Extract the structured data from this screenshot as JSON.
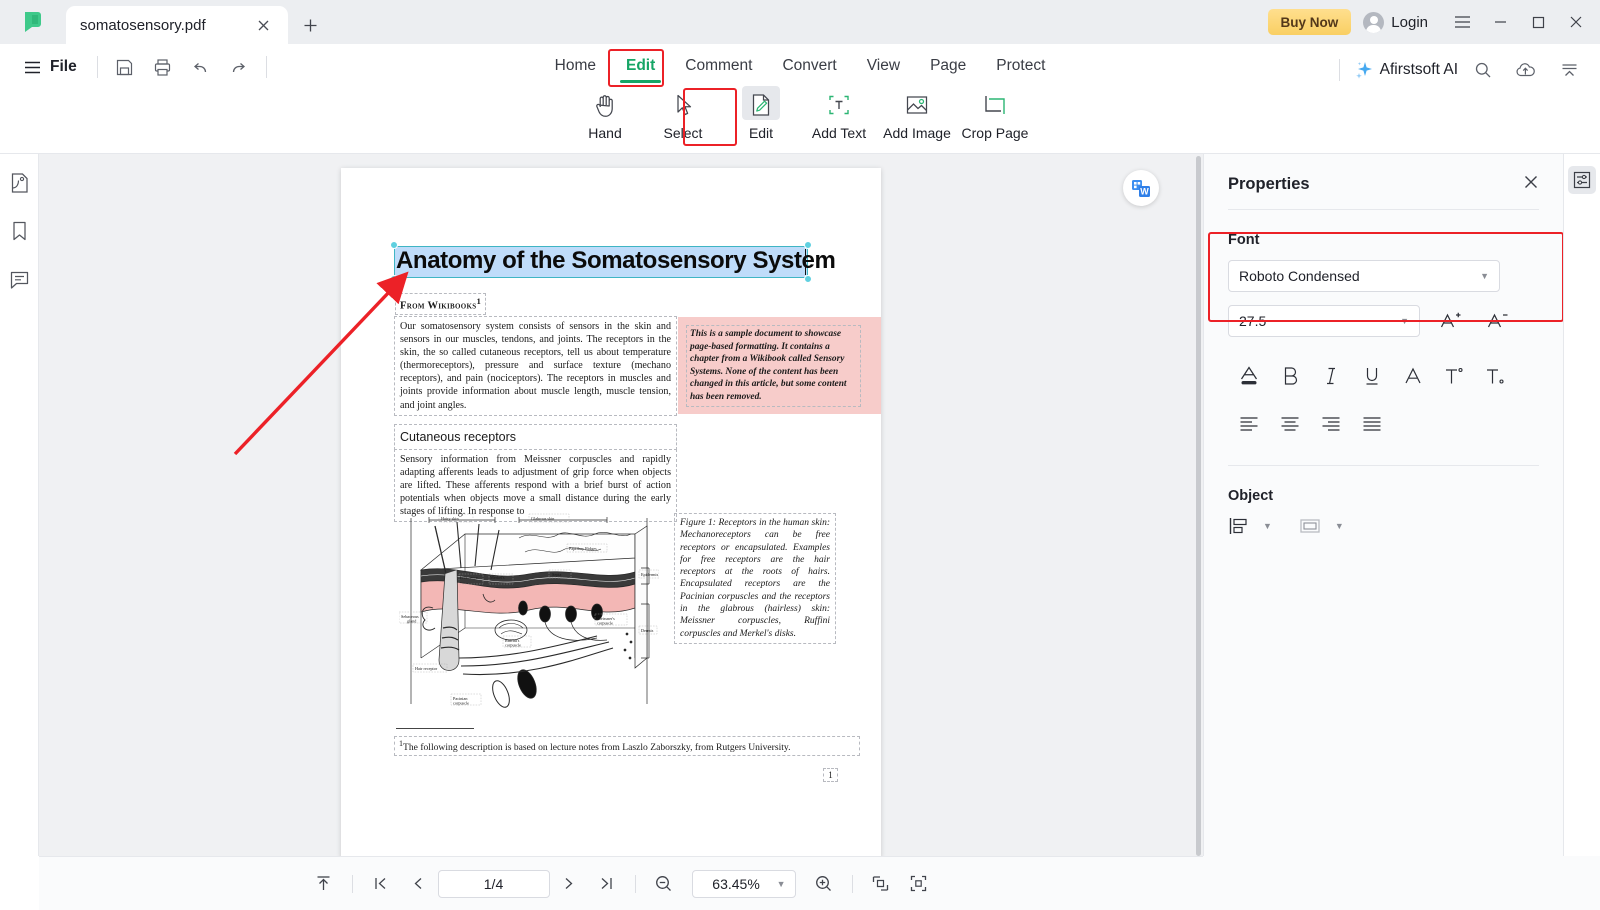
{
  "titlebar": {
    "logo_icon": "afirstsoft-logo-icon",
    "tab_title": "somatosensory.pdf",
    "close_icon": "close-icon",
    "new_tab_icon": "plus-icon",
    "buy_now_label": "Buy Now",
    "login_label": "Login",
    "menu_icon": "hamburger-menu-icon",
    "minimize_icon": "minimize-icon",
    "maximize_icon": "maximize-icon",
    "window_close_icon": "close-icon"
  },
  "ribbon": {
    "file_label": "File",
    "quick_icons": [
      "save-icon",
      "print-icon",
      "undo-icon",
      "redo-icon"
    ],
    "tabs": [
      {
        "label": "Home",
        "active": false
      },
      {
        "label": "Edit",
        "active": true
      },
      {
        "label": "Comment",
        "active": false
      },
      {
        "label": "Convert",
        "active": false
      },
      {
        "label": "View",
        "active": false
      },
      {
        "label": "Page",
        "active": false
      },
      {
        "label": "Protect",
        "active": false
      }
    ],
    "ai_label": "Afirstsoft AI",
    "search_icon": "search-icon",
    "cloud_upload_icon": "cloud-upload-icon",
    "collapse_ribbon_icon": "collapse-ribbon-icon",
    "tools": [
      {
        "label": "Hand",
        "icon": "hand-icon",
        "selected": false
      },
      {
        "label": "Select",
        "icon": "cursor-arrow-icon",
        "selected": false
      },
      {
        "label": "Edit",
        "icon": "edit-document-icon",
        "selected": true
      },
      {
        "label": "Add Text",
        "icon": "add-text-icon",
        "selected": false
      },
      {
        "label": "Add Image",
        "icon": "add-image-icon",
        "selected": false
      },
      {
        "label": "Crop Page",
        "icon": "crop-page-icon",
        "selected": false
      }
    ]
  },
  "left_rail": {
    "items": [
      {
        "icon": "page-thumbnails-icon"
      },
      {
        "icon": "bookmark-icon"
      },
      {
        "icon": "comment-icon"
      }
    ]
  },
  "viewer": {
    "convert_to_word_icon": "convert-to-word-icon",
    "document": {
      "title": "Anatomy of the Somatosensory System",
      "source_line": "From Wikibooks",
      "source_footnote_marker": "1",
      "paragraph_1": "Our somatosensory system consists of sensors in the skin and sensors in our muscles, tendons, and joints. The receptors in the skin, the so called cutaneous receptors, tell us about temperature (thermoreceptors), pressure and surface texture (mechano receptors), and pain (nociceptors). The receptors in muscles and joints provide information about muscle length, muscle tension, and joint angles.",
      "pink_note": "This is a sample document to showcase page-based formatting. It contains a chapter from a Wikibook called Sensory Systems. None of the content has been changed in this article, but some content has been removed.",
      "heading_2": "Cutaneous receptors",
      "paragraph_2": "Sensory information from Meissner corpuscles and rapidly adapting afferents leads to adjustment of grip force when objects are lifted. These afferents respond with a brief burst of action potentials when objects move a small distance during the early stages of lifting. In response to",
      "figure_caption": "Figure 1: Receptors in the human skin: Mechanoreceptors can be free receptors or encapsulated. Examples for free receptors are the hair receptors at the roots of hairs. Encapsulated receptors are the Pacinian corpuscles and the receptors in the glabrous (hairless) skin: Meissner corpuscles, Ruffini corpuscles and Merkel's disks.",
      "footnote": "The following description is based on lecture notes from Laszlo Zaborszky, from Rutgers University.",
      "footnote_marker": "1",
      "page_number": "1",
      "figure_labels": {
        "hairy_skin": "Hairy skin",
        "glabrous_skin": "Glabrous skin",
        "papillary_ridges": "Papillary Ridges",
        "septa": "Septa",
        "epidermis": "Epidermis",
        "dermis": "Dermis",
        "free_nerve": "Free nerve ending",
        "merkels": "Merkel's cells",
        "sebaceous_gland": "Sebaceous gland",
        "meissners": "Meissner's corpuscle",
        "ruffinis": "Ruffini's corpuscle",
        "hair_receptor": "Hair receptor",
        "pacinian": "Pacinian corpuscle"
      }
    }
  },
  "properties": {
    "title": "Properties",
    "close_icon": "close-icon",
    "font_section_label": "Font",
    "font_family_value": "Roboto Condensed",
    "font_size_value": "27.5",
    "increase_font_icon": "increase-font-size-icon",
    "decrease_font_icon": "decrease-font-size-icon",
    "format_buttons": [
      {
        "icon": "font-color-icon",
        "label": "A"
      },
      {
        "icon": "bold-icon",
        "label": "B"
      },
      {
        "icon": "italic-icon",
        "label": "I"
      },
      {
        "icon": "underline-icon",
        "label": "U"
      },
      {
        "icon": "strikethrough-icon",
        "label": "A"
      },
      {
        "icon": "superscript-icon",
        "label": "T"
      },
      {
        "icon": "subscript-icon",
        "label": "T"
      }
    ],
    "align_buttons": [
      {
        "icon": "align-left-icon"
      },
      {
        "icon": "align-center-icon"
      },
      {
        "icon": "align-right-icon"
      },
      {
        "icon": "align-justify-icon"
      }
    ],
    "object_section_label": "Object",
    "object_buttons": [
      {
        "icon": "object-align-icon"
      },
      {
        "icon": "object-arrange-icon"
      }
    ],
    "highlight_color": "#ec2127"
  },
  "right_rail": {
    "properties_toggle_icon": "properties-panel-icon"
  },
  "statusbar": {
    "scroll_to_top_icon": "scroll-to-top-icon",
    "first_page_icon": "first-page-icon",
    "prev_page_icon": "previous-page-icon",
    "page_value": "1/4",
    "next_page_icon": "next-page-icon",
    "last_page_icon": "last-page-icon",
    "zoom_out_icon": "zoom-out-icon",
    "zoom_value": "63.45%",
    "zoom_in_icon": "zoom-in-icon",
    "fit_width_icon": "fit-width-icon",
    "fit_page_icon": "fit-page-icon"
  }
}
